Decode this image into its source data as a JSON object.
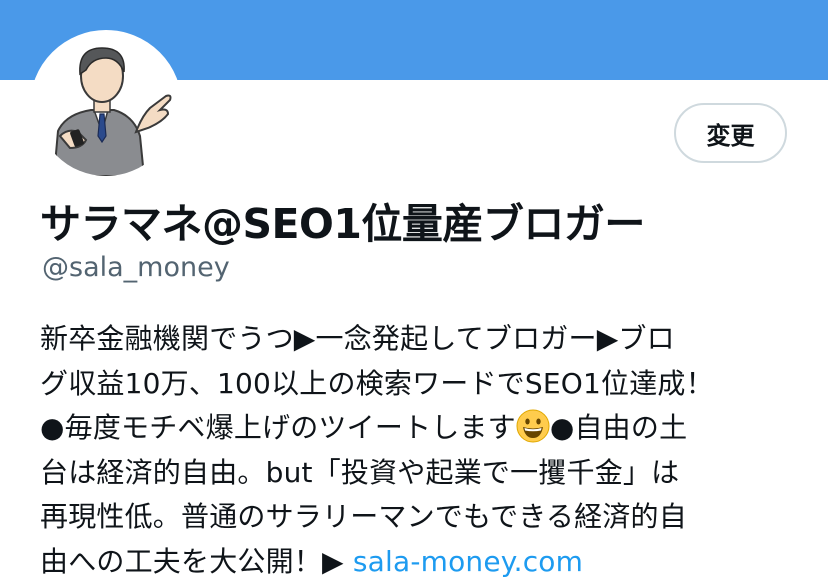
{
  "profile": {
    "edit_label": "変更",
    "display_name": "サラマネ@SEO1位量産ブロガー",
    "handle": "@sala_money",
    "bio": {
      "line1": "新卒金融機関でうつ▶︎一念発起してブロガー▶︎ブロ",
      "line2": "グ収益10万、100以上の検索ワードでSEO1位達成！",
      "line3a": "●毎度モチベ爆上げのツイートします",
      "line3b": "●自由の土",
      "line4": "台は経済的自由。but「投資や起業で一攫千金」は",
      "line5": "再現性低。普通のサラリーマンでもできる経済的自",
      "line6": "由への工夫を大公開！▶︎ ",
      "link": "sala-money.com"
    }
  },
  "colors": {
    "banner": "#4a99e9",
    "link": "#1d9bf0",
    "secondary_text": "#536471"
  },
  "icons": {
    "emoji": "grinning-face-icon",
    "avatar": "businessman-illustration"
  }
}
